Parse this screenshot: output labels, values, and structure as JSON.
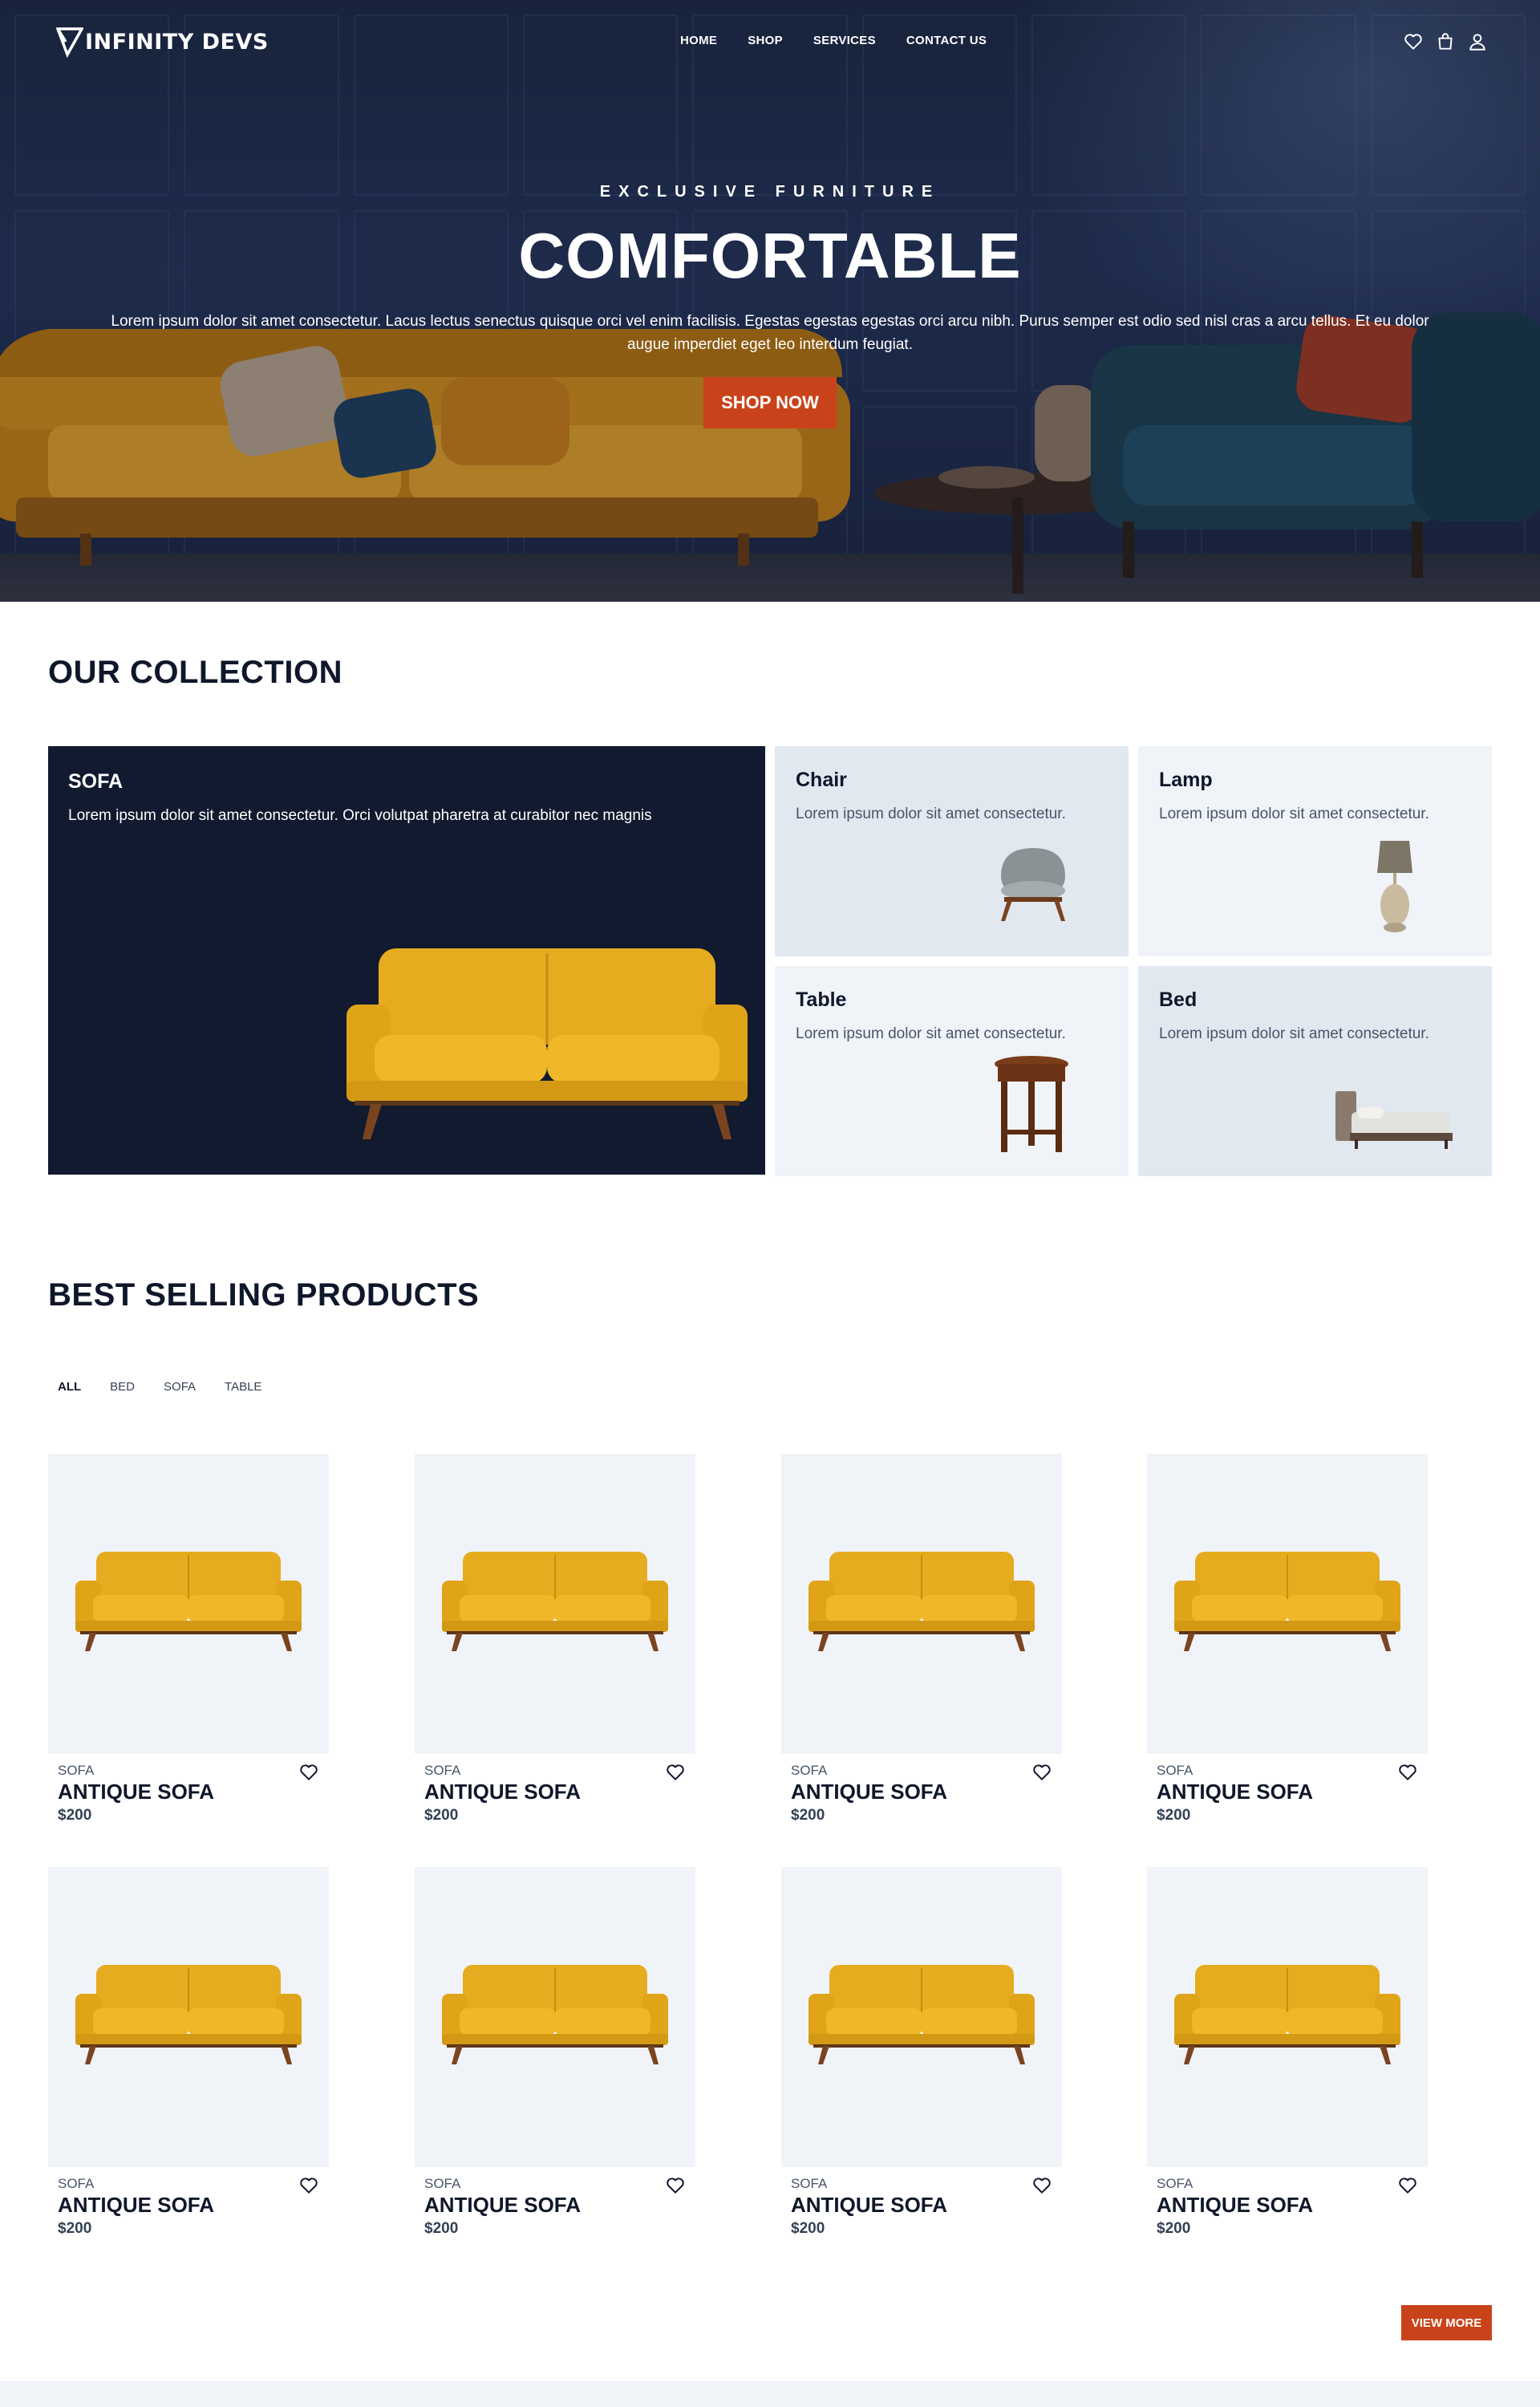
{
  "brand": {
    "logo_text": "INFINITY DEVS"
  },
  "nav": {
    "items": [
      {
        "label": "HOME"
      },
      {
        "label": "SHOP"
      },
      {
        "label": "SERVICES"
      },
      {
        "label": "CONTACT US"
      }
    ],
    "icons": [
      "heart-icon",
      "cart-icon",
      "user-icon"
    ]
  },
  "hero": {
    "eyebrow": "EXCLUSIVE FURNITURE",
    "title": "COMFORTABLE",
    "description": "Lorem ipsum dolor sit amet consectetur. Lacus lectus senectus quisque orci vel enim facilisis. Egestas egestas egestas orci arcu nibh. Purus semper est odio sed nisl cras a arcu tellus. Et eu dolor augue imperdiet eget leo interdum feugiat.",
    "cta_label": "SHOP NOW"
  },
  "collection": {
    "heading": "OUR COLLECTION",
    "featured": {
      "title": "SOFA",
      "description": "Lorem ipsum dolor sit amet consectetur. Orci volutpat pharetra at curabitor nec magnis"
    },
    "items": [
      {
        "title": "Chair",
        "description": "Lorem ipsum dolor sit amet consectetur."
      },
      {
        "title": "Lamp",
        "description": "Lorem ipsum dolor sit amet consectetur."
      },
      {
        "title": "Table",
        "description": "Lorem ipsum dolor sit amet consectetur."
      },
      {
        "title": "Bed",
        "description": "Lorem ipsum dolor sit amet consectetur."
      }
    ]
  },
  "products": {
    "heading": "BEST SELLING PRODUCTS",
    "filters": [
      {
        "label": "ALL",
        "active": true
      },
      {
        "label": "BED"
      },
      {
        "label": "SOFA"
      },
      {
        "label": "TABLE"
      }
    ],
    "items": [
      {
        "category": "SOFA",
        "name": "ANTIQUE SOFA",
        "price": "$200"
      },
      {
        "category": "SOFA",
        "name": "ANTIQUE SOFA",
        "price": "$200"
      },
      {
        "category": "SOFA",
        "name": "ANTIQUE SOFA",
        "price": "$200"
      },
      {
        "category": "SOFA",
        "name": "ANTIQUE SOFA",
        "price": "$200"
      },
      {
        "category": "SOFA",
        "name": "ANTIQUE SOFA",
        "price": "$200"
      },
      {
        "category": "SOFA",
        "name": "ANTIQUE SOFA",
        "price": "$200"
      },
      {
        "category": "SOFA",
        "name": "ANTIQUE SOFA",
        "price": "$200"
      },
      {
        "category": "SOFA",
        "name": "ANTIQUE SOFA",
        "price": "$200"
      }
    ],
    "view_more_label": "VIEW MORE"
  },
  "colors": {
    "accent": "#c9431a",
    "dark_navy": "#111a2e",
    "card_bg": "#f0f3f8",
    "mustard": "#e6ac1f"
  }
}
